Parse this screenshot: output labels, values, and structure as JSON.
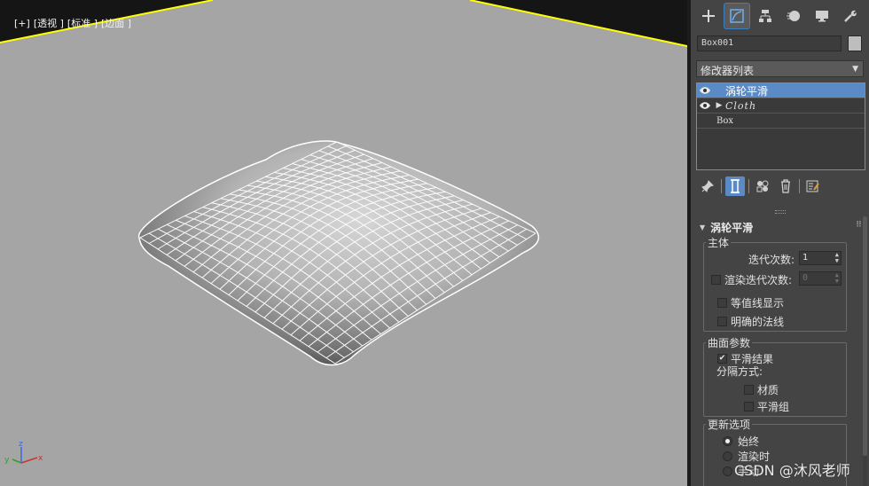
{
  "viewport": {
    "label_parts": [
      "[+]",
      "[透视 ]",
      "[标准 ]",
      "[边面 ]"
    ],
    "axis": {
      "x": "x",
      "y": "y",
      "z": "z"
    },
    "colors": {
      "background": "#a5a5a5",
      "grid_line": "#ffff00",
      "mesh": "#ffffff"
    }
  },
  "panel": {
    "tabs": [
      {
        "icon": "create-plus-icon"
      },
      {
        "icon": "modify-icon",
        "active": true
      },
      {
        "icon": "hierarchy-icon"
      },
      {
        "icon": "motion-icon"
      },
      {
        "icon": "display-icon"
      },
      {
        "icon": "utilities-wrench-icon"
      }
    ],
    "object_name": "Box001",
    "modifier_list_label": "修改器列表",
    "stack": [
      {
        "label": "涡轮平滑",
        "visible": true,
        "selected": true
      },
      {
        "label": "Cloth",
        "visible": true,
        "expandable": true
      },
      {
        "label": "Box"
      }
    ],
    "stack_tools": [
      "pin-stack-icon",
      "show-end-result-icon",
      "make-unique-icon",
      "remove-modifier-icon",
      "configure-sets-icon"
    ],
    "rollout": {
      "title": "涡轮平滑",
      "main_group": {
        "title": "主体",
        "iterations_label": "迭代次数:",
        "iterations_value": "1",
        "render_iters_label": "渲染迭代次数:",
        "render_iters_value": "0",
        "isoline_label": "等值线显示",
        "explicit_normals_label": "明确的法线"
      },
      "surface_group": {
        "title": "曲面参数",
        "smooth_result_label": "平滑结果",
        "separate_by_label": "分隔方式:",
        "materials_label": "材质",
        "smoothing_groups_label": "平滑组"
      },
      "update_group": {
        "title": "更新选项",
        "always_label": "始终",
        "when_rendering_label": "渲染时",
        "manually_label": "手动"
      }
    }
  },
  "watermark": "CSDN @沐风老师",
  "accent_color": "#5b8bc7"
}
